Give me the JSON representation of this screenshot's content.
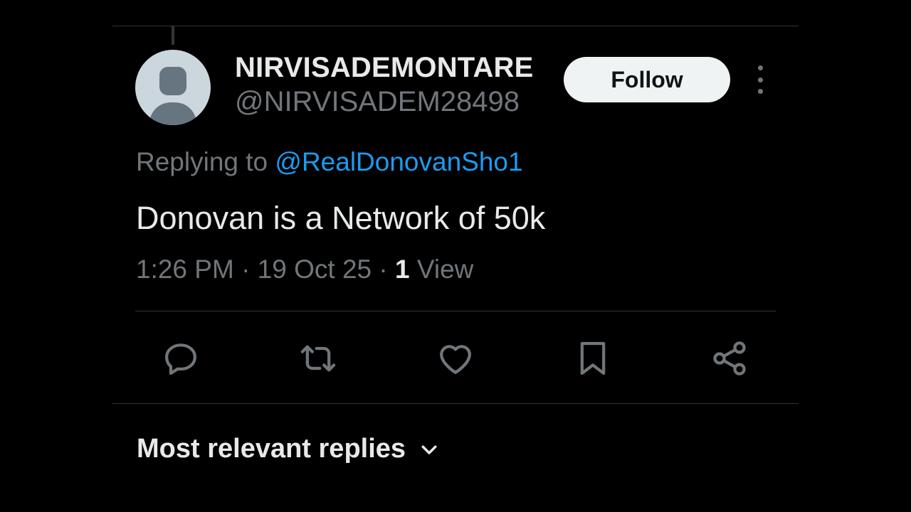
{
  "tweet": {
    "author": {
      "display_name": "NIRVISADEMONTARE",
      "handle": "@NIRVISADEM28498",
      "avatar_icon": "default-avatar-icon"
    },
    "follow_label": "Follow",
    "replying_prefix": "Replying to ",
    "replying_to": "@RealDonovanSho1",
    "text": "Donovan is a Network of 50k",
    "time": "1:26 PM",
    "separator": " · ",
    "date": "19 Oct 25",
    "views_count": "1",
    "views_label": " View"
  },
  "actions": [
    {
      "name": "reply",
      "icon": "reply-icon"
    },
    {
      "name": "repost",
      "icon": "repost-icon"
    },
    {
      "name": "like",
      "icon": "heart-icon"
    },
    {
      "name": "bookmark",
      "icon": "bookmark-icon"
    },
    {
      "name": "share",
      "icon": "share-icon"
    }
  ],
  "replies": {
    "sort_label": "Most relevant replies",
    "sort_icon": "chevron-down-icon"
  },
  "colors": {
    "background": "#000000",
    "primary_text": "#e7e9ea",
    "secondary_text": "#71767b",
    "accent": "#1d9bf0",
    "divider": "#2f3336",
    "follow_bg": "#eff3f4"
  }
}
